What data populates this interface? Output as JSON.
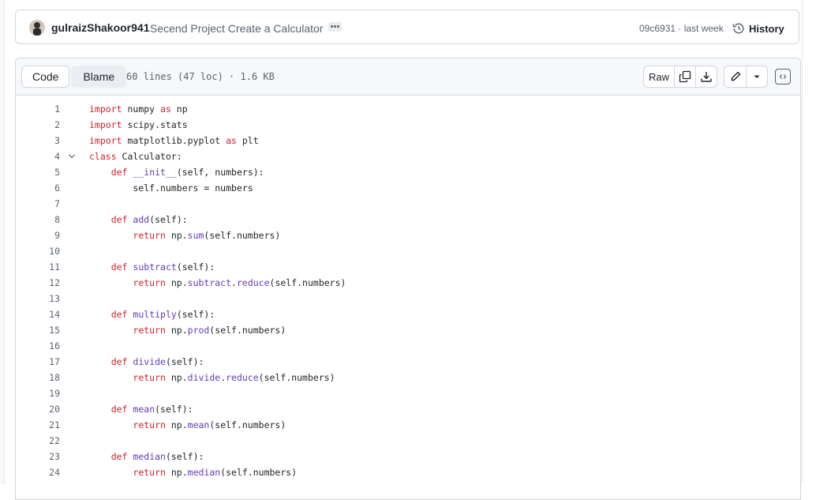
{
  "commit": {
    "author": "gulraizShakoor941",
    "message": "Secend Project Create a Calculator",
    "hash_time": "09c6931 · last week",
    "history_label": "History"
  },
  "file_header": {
    "tab_code": "Code",
    "tab_blame": "Blame",
    "info": "60 lines (47 loc) · 1.6 KB",
    "raw_label": "Raw"
  },
  "icons": {
    "avatar": "avatar",
    "ellipsis": "kebab-horizontal-icon",
    "history": "history-clock-icon",
    "copy": "copy-icon",
    "download": "download-icon",
    "edit": "pencil-icon",
    "dropdown": "triangle-down-icon",
    "symbols": "code-square-icon",
    "fold": "chevron-down-icon"
  },
  "colors": {
    "keyword": "#cf222e",
    "function": "#6639ba",
    "text": "#1f2328",
    "muted": "#59636e"
  },
  "lines": [
    {
      "n": "1",
      "t": "import numpy as np"
    },
    {
      "n": "2",
      "t": "import scipy.stats"
    },
    {
      "n": "3",
      "t": "import matplotlib.pyplot as plt"
    },
    {
      "n": "4",
      "t": "class Calculator:"
    },
    {
      "n": "5",
      "t": "    def __init__(self, numbers):"
    },
    {
      "n": "6",
      "t": "        self.numbers = numbers"
    },
    {
      "n": "7",
      "t": ""
    },
    {
      "n": "8",
      "t": "    def add(self):"
    },
    {
      "n": "9",
      "t": "        return np.sum(self.numbers)"
    },
    {
      "n": "10",
      "t": ""
    },
    {
      "n": "11",
      "t": "    def subtract(self):"
    },
    {
      "n": "12",
      "t": "        return np.subtract.reduce(self.numbers)"
    },
    {
      "n": "13",
      "t": ""
    },
    {
      "n": "14",
      "t": "    def multiply(self):"
    },
    {
      "n": "15",
      "t": "        return np.prod(self.numbers)"
    },
    {
      "n": "16",
      "t": ""
    },
    {
      "n": "17",
      "t": "    def divide(self):"
    },
    {
      "n": "18",
      "t": "        return np.divide.reduce(self.numbers)"
    },
    {
      "n": "19",
      "t": ""
    },
    {
      "n": "20",
      "t": "    def mean(self):"
    },
    {
      "n": "21",
      "t": "        return np.mean(self.numbers)"
    },
    {
      "n": "22",
      "t": ""
    },
    {
      "n": "23",
      "t": "    def median(self):"
    },
    {
      "n": "24",
      "t": "        return np.median(self.numbers)"
    }
  ]
}
